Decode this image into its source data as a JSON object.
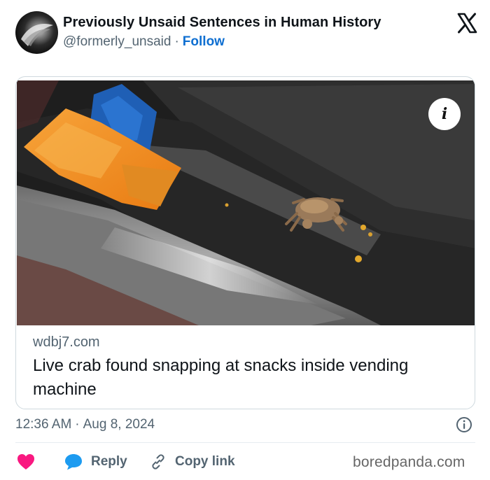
{
  "header": {
    "account_name": "Previously Unsaid Sentences in Human History",
    "handle": "@formerly_unsaid",
    "separator": "·",
    "follow_label": "Follow",
    "platform_icon": "x-logo-icon"
  },
  "card": {
    "image_icon": "info-icon",
    "info_glyph": "i",
    "domain": "wdbj7.com",
    "title": "Live crab found snapping at snacks inside vending machine"
  },
  "meta": {
    "time": "12:36 AM",
    "separator": "·",
    "date": "Aug 8, 2024"
  },
  "actions": {
    "like_icon": "heart-icon",
    "reply_label": "Reply",
    "copy_label": "Copy link"
  },
  "watermark": "boredpanda.com",
  "colors": {
    "follow": "#0f6fd1",
    "heart": "#f91880",
    "reply_bubble": "#1d9bf0",
    "secondary_text": "#536471"
  }
}
